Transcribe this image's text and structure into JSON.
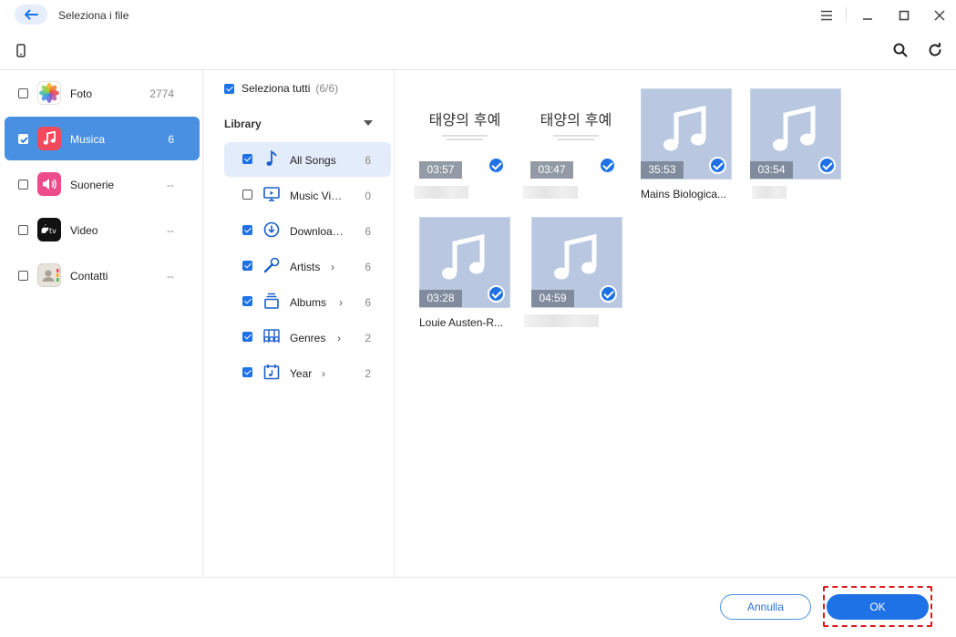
{
  "window": {
    "title": "Seleziona i file",
    "icons": {
      "back": "arrow-left-icon",
      "menu": "menu-icon",
      "minimize": "minimize-icon",
      "maximize": "maximize-icon",
      "close": "close-icon"
    }
  },
  "toolbar": {
    "device_icon": "phone-icon",
    "search_icon": "search-icon",
    "refresh_icon": "refresh-icon"
  },
  "categories": [
    {
      "label": "Foto",
      "count": "2774",
      "checked": false,
      "active": false,
      "icon": "photos-icon"
    },
    {
      "label": "Musica",
      "count": "6",
      "checked": true,
      "active": true,
      "icon": "music-icon"
    },
    {
      "label": "Suonerie",
      "count": "--",
      "checked": false,
      "active": false,
      "icon": "ringtone-icon"
    },
    {
      "label": "Video",
      "count": "--",
      "checked": false,
      "active": false,
      "icon": "apple-tv-icon"
    },
    {
      "label": "Contatti",
      "count": "--",
      "checked": false,
      "active": false,
      "icon": "contacts-icon"
    }
  ],
  "library": {
    "select_all_label": "Seleziona tutti",
    "select_all_count": "(6/6)",
    "header": "Library",
    "items": [
      {
        "label": "All Songs",
        "count": "6",
        "checked": true,
        "active": true,
        "chevron": false,
        "icon": "note-icon"
      },
      {
        "label": "Music Videos",
        "count": "0",
        "checked": false,
        "active": false,
        "chevron": false,
        "icon": "monitor-icon"
      },
      {
        "label": "Downloaded",
        "count": "6",
        "checked": true,
        "active": false,
        "chevron": false,
        "icon": "download-icon"
      },
      {
        "label": "Artists",
        "count": "6",
        "checked": true,
        "active": false,
        "chevron": true,
        "icon": "microphone-icon"
      },
      {
        "label": "Albums",
        "count": "6",
        "checked": true,
        "active": false,
        "chevron": true,
        "icon": "album-icon"
      },
      {
        "label": "Genres",
        "count": "2",
        "checked": true,
        "active": false,
        "chevron": true,
        "icon": "genres-icon"
      },
      {
        "label": "Year",
        "count": "2",
        "checked": true,
        "active": false,
        "chevron": true,
        "icon": "calendar-icon"
      }
    ]
  },
  "songs": [
    {
      "duration": "03:57",
      "name": "",
      "artwork": "album-art",
      "checked": true
    },
    {
      "duration": "03:47",
      "name": "",
      "artwork": "album-art",
      "checked": true
    },
    {
      "duration": "35:53",
      "name": "Mains Biologica...",
      "artwork": "music-note",
      "checked": true
    },
    {
      "duration": "03:54",
      "name": "",
      "artwork": "music-note",
      "checked": true
    },
    {
      "duration": "03:28",
      "name": "Louie Austen-R...",
      "artwork": "music-note",
      "checked": true
    },
    {
      "duration": "04:59",
      "name": "",
      "artwork": "music-note",
      "checked": true
    }
  ],
  "footer": {
    "cancel_label": "Annulla",
    "ok_label": "OK"
  },
  "colors": {
    "accent": "#1e72e6",
    "active_category": "#4a90e2",
    "highlight_box": "#d91a1a"
  }
}
